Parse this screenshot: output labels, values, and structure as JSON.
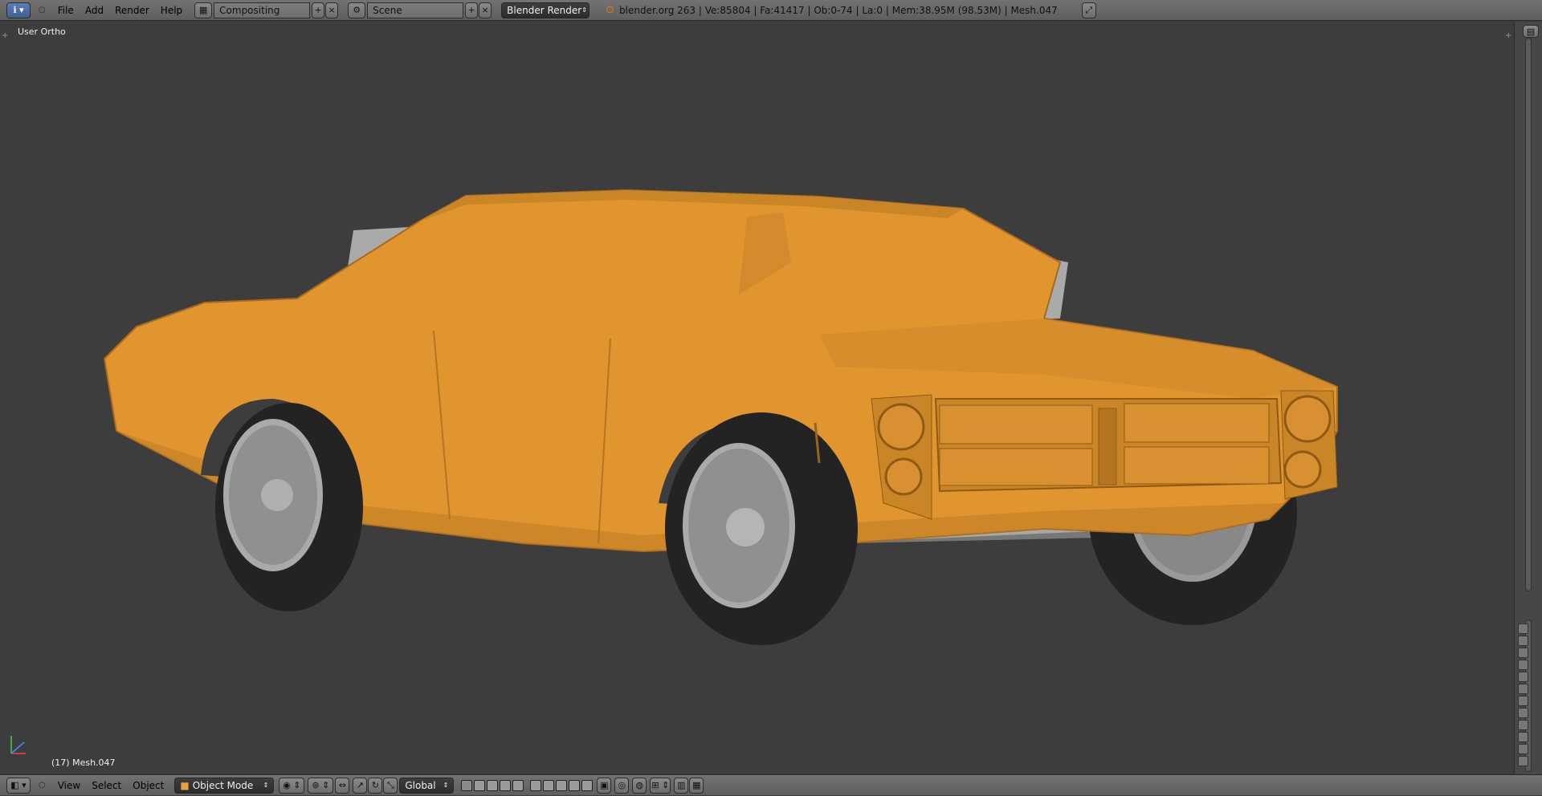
{
  "header": {
    "menus": [
      "File",
      "Add",
      "Render",
      "Help"
    ],
    "layout": "Compositing",
    "scene": "Scene",
    "engine": "Blender Render",
    "status": "blender.org 263 | Ve:85804 | Fa:41417 | Ob:0-74 | La:0 | Mem:38.95M (98.53M) | Mesh.047"
  },
  "viewport": {
    "view_name": "User Ortho",
    "object_label": "(17) Mesh.047"
  },
  "footer": {
    "menus": [
      "View",
      "Select",
      "Object"
    ],
    "mode": "Object Mode",
    "orientation": "Global"
  },
  "colors": {
    "body": "#e0952f",
    "interior": "#aaaaaa",
    "tire": "#232323",
    "background": "#3d3d3d"
  }
}
